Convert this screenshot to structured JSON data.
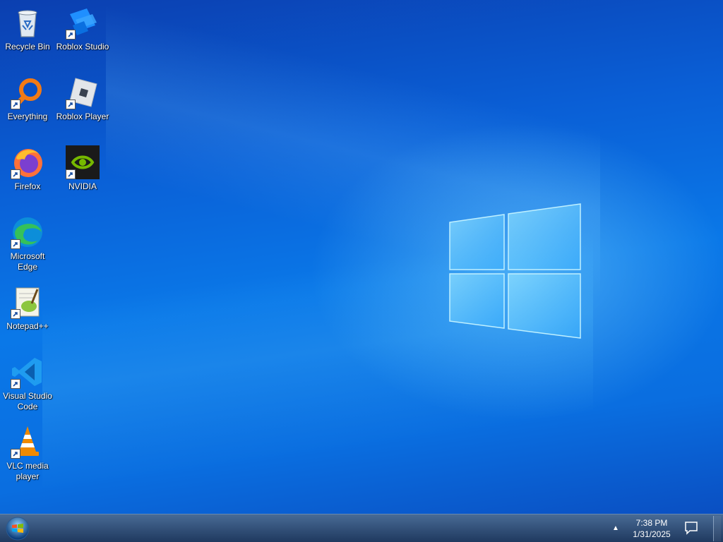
{
  "desktop": {
    "icons": [
      {
        "label": "Recycle Bin",
        "icon": "recycle-bin-icon"
      },
      {
        "label": "Roblox Studio",
        "icon": "roblox-studio-icon"
      },
      {
        "label": "Everything",
        "icon": "everything-search-icon"
      },
      {
        "label": "Roblox Player",
        "icon": "roblox-player-icon"
      },
      {
        "label": "Firefox",
        "icon": "firefox-icon"
      },
      {
        "label": "NVIDIA",
        "icon": "nvidia-icon"
      },
      {
        "label": "Microsoft Edge",
        "icon": "edge-icon"
      },
      {
        "label": "Notepad++",
        "icon": "notepad-plus-plus-icon"
      },
      {
        "label": "Visual Studio Code",
        "icon": "vscode-icon"
      },
      {
        "label": "VLC media player",
        "icon": "vlc-icon"
      }
    ]
  },
  "taskbar": {
    "start_icon": "windows-start-orb-icon",
    "tray_arrow": "▲",
    "time": "7:38 PM",
    "date": "1/31/2025",
    "notification_icon": "action-center-icon"
  },
  "colors": {
    "wallpaper_blue": "#0a78e8",
    "taskbar": "#1b3a63"
  }
}
